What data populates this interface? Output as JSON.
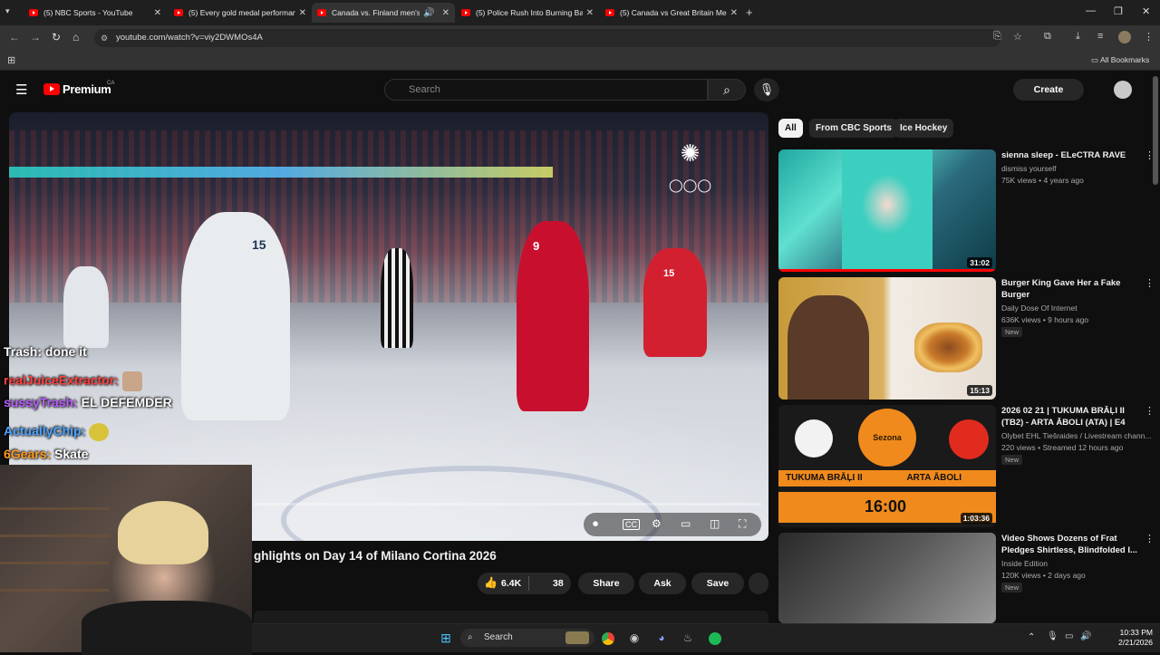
{
  "browser": {
    "tabs": [
      {
        "title": "(5) NBC Sports - YouTube"
      },
      {
        "title": "(5) Every gold medal performance"
      },
      {
        "title": "Canada vs. Finland men's h"
      },
      {
        "title": "(5) Police Rush Into Burning Ba"
      },
      {
        "title": "(5) Canada vs Great Britain Men"
      }
    ],
    "url": "youtube.com/watch?v=viy2DWMOs4A",
    "all_bookmarks": "All Bookmarks"
  },
  "youtube": {
    "logo": "Premium",
    "region": "CA",
    "search_placeholder": "Search",
    "create_label": "Create"
  },
  "video": {
    "title_visible": "ghlights on Day 14 of Milano Cortina 2026",
    "likes": "6.4K",
    "dislikes": "38",
    "share_label": "Share",
    "ask_label": "Ask",
    "save_label": "Save",
    "jersey_numbers": [
      "15",
      "9",
      "15"
    ]
  },
  "chat": [
    {
      "user": "Trash: done it",
      "text": "",
      "color": "#ffffff"
    },
    {
      "user": "realJuiceExtractor:",
      "text": "",
      "color": "#ff4040"
    },
    {
      "user": "sussyTrash:",
      "text": "EL DEFEMDER",
      "color": "#b85cff"
    },
    {
      "user": "ActuallyChip:",
      "text": "",
      "color": "#4aa3ff"
    },
    {
      "user": "6Gears:",
      "text": "Skate",
      "color": "#ff9a1f"
    }
  ],
  "chips": [
    "All",
    "From CBC Sports",
    "Ice Hockey"
  ],
  "recommendations": [
    {
      "title": "sienna sleep - ELeCTRA RAVE",
      "channel": "dismiss yourself",
      "meta": "75K views • 4 years ago",
      "duration": "31:02",
      "badge": ""
    },
    {
      "title": "Burger King Gave Her a Fake Burger",
      "channel": "Daily Dose Of Internet",
      "meta": "636K views • 9 hours ago",
      "duration": "15:13",
      "badge": "New"
    },
    {
      "title": "2026 02 21 | TUKUMA BRĀĻI II (TB2) - ARTA ĀBOLI (ATA) | E4",
      "channel": "Olybet EHL Tiešraides / Livestream chann...",
      "meta": "220 views • Streamed 12 hours ago",
      "duration": "1:03:36",
      "badge": "New",
      "thumb_left": "TUKUMA BRĀĻI II",
      "thumb_right": "ARTA ĀBOLI",
      "thumb_time": "16:00",
      "thumb_brand": "Sezona"
    },
    {
      "title": "Video Shows Dozens of Frat Pledges Shirtless, Blindfolded I...",
      "channel": "Inside Edition",
      "meta": "120K views • 2 days ago",
      "duration": "",
      "badge": "New"
    }
  ],
  "taskbar": {
    "search_label": "Search",
    "time": "10:33 PM",
    "date": "2/21/2026"
  }
}
